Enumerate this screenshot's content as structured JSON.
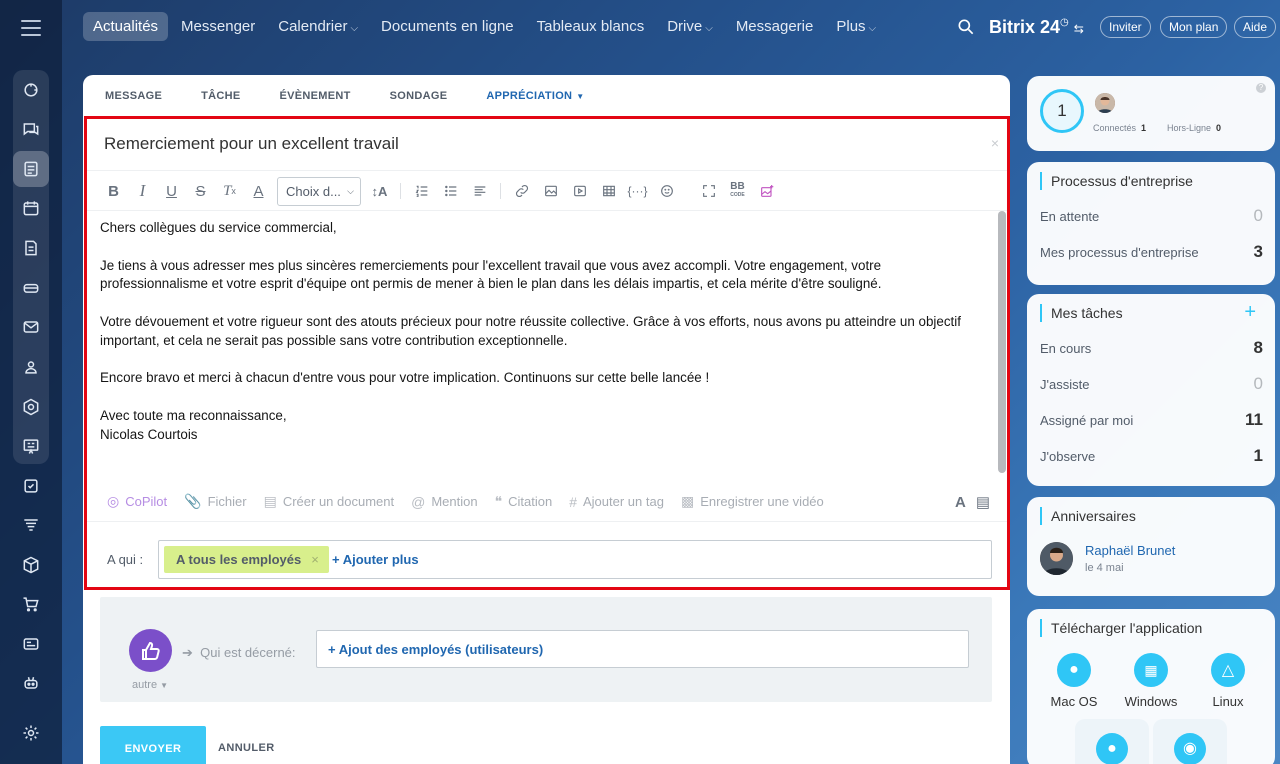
{
  "rail": {
    "icons": [
      "home-icon",
      "chat-icon",
      "feed-icon",
      "calendar-icon",
      "document-icon",
      "drive-icon",
      "mail-icon",
      "contacts-icon",
      "hexagon-icon",
      "board-icon",
      "tasks-icon",
      "filter-icon",
      "box-icon",
      "cart-icon",
      "card-icon",
      "robot-icon",
      "settings-icon"
    ]
  },
  "nav": {
    "items": [
      {
        "label": "Actualités",
        "active": true,
        "chevron": false
      },
      {
        "label": "Messenger",
        "active": false,
        "chevron": false
      },
      {
        "label": "Calendrier",
        "active": false,
        "chevron": true
      },
      {
        "label": "Documents en ligne",
        "active": false,
        "chevron": false
      },
      {
        "label": "Tableaux blancs",
        "active": false,
        "chevron": false
      },
      {
        "label": "Drive",
        "active": false,
        "chevron": true
      },
      {
        "label": "Messagerie",
        "active": false,
        "chevron": false
      },
      {
        "label": "Plus",
        "active": false,
        "chevron": true
      }
    ],
    "brand": "Bitrix 24",
    "invite": "Inviter",
    "plan": "Mon plan",
    "help": "Aide"
  },
  "composer": {
    "tabs": [
      "MESSAGE",
      "TÂCHE",
      "ÉVÈNEMENT",
      "SONDAGE",
      "APPRÉCIATION"
    ],
    "active_tab": "APPRÉCIATION",
    "subject": "Remerciement pour un excellent travail",
    "font_select": "Choix d...",
    "body": {
      "greeting": "Chers collègues du service commercial,",
      "p1": "Je tiens à vous adresser mes plus sincères remerciements pour l'excellent travail que vous avez accompli. Votre engagement, votre professionnalisme et votre esprit d'équipe ont permis de mener à bien le plan dans les délais impartis, et cela mérite d'être souligné.",
      "p2": "Votre dévouement et votre rigueur sont des atouts précieux pour notre réussite collective. Grâce à vos efforts, nous avons pu atteindre un objectif important, et cela ne serait pas possible sans votre contribution exceptionnelle.",
      "p3": "Encore bravo et merci à chacun d'entre vous pour votre implication. Continuons sur cette belle lancée !",
      "closing": "Avec toute ma reconnaissance,",
      "signature": "Nicolas Courtois"
    },
    "actions": {
      "copilot": "CoPilot",
      "file": "Fichier",
      "create_doc": "Créer un document",
      "mention": "Mention",
      "quote": "Citation",
      "tag": "Ajouter un tag",
      "video": "Enregistrer une vidéo"
    },
    "recipients_label": "A qui :",
    "recipient_tag": "A tous les employés",
    "add_more": "+ Ajouter plus",
    "award_type": "autre",
    "awarded_label": "Qui est décerné:",
    "add_employees": "+ Ajout des employés (utilisateurs)",
    "send": "ENVOYER",
    "cancel": "ANNULER"
  },
  "online": {
    "count": "1",
    "connected_label": "Connectés",
    "connected_count": "1",
    "offline_label": "Hors-Ligne",
    "offline_count": "0"
  },
  "business": {
    "title": "Processus d'entreprise",
    "rows": [
      {
        "label": "En attente",
        "value": "0"
      },
      {
        "label": "Mes processus d'entreprise",
        "value": "3"
      }
    ]
  },
  "tasks": {
    "title": "Mes tâches",
    "rows": [
      {
        "label": "En cours",
        "value": "8"
      },
      {
        "label": "J'assiste",
        "value": "0"
      },
      {
        "label": "Assigné par moi",
        "value": "11"
      },
      {
        "label": "J'observe",
        "value": "1"
      }
    ]
  },
  "birthdays": {
    "title": "Anniversaires",
    "name": "Raphaël Brunet",
    "date": "le 4 mai"
  },
  "apps": {
    "title": "Télécharger l'application",
    "os": [
      "Mac OS",
      "Windows",
      "Linux"
    ]
  },
  "colors": {
    "accent": "#2fc6f6",
    "link": "#2067b0",
    "highlight_border": "#e30613",
    "tag_bg": "#d8ef8c",
    "award_purple": "#7b4fc9"
  }
}
